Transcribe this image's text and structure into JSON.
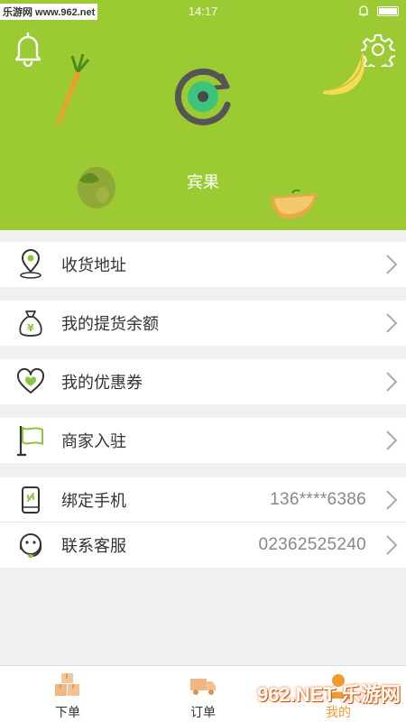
{
  "status_bar": {
    "watermark": "乐游网 www.962.net",
    "time": "14:17"
  },
  "header": {
    "shop_name": "宾果",
    "bg_color": "#9cca32"
  },
  "menu": {
    "address": {
      "label": "收货地址",
      "icon": "location-pin-icon"
    },
    "balance": {
      "label": "我的提货余额",
      "icon": "money-bag-icon"
    },
    "coupons": {
      "label": "我的优惠券",
      "icon": "heart-icon"
    },
    "merchant": {
      "label": "商家入驻",
      "icon": "flag-icon"
    },
    "phone": {
      "label": "绑定手机",
      "value": "136****6386",
      "icon": "mobile-phone-icon"
    },
    "service": {
      "label": "联系客服",
      "value": "02362525240",
      "icon": "headset-icon"
    }
  },
  "tabs": {
    "order": {
      "label": "下单",
      "icon": "boxes-icon"
    },
    "orders": {
      "label": "订单",
      "icon": "truck-icon"
    },
    "mine": {
      "label": "我的",
      "icon": "user-icon"
    }
  },
  "brand_watermark": "962.NET 乐游网"
}
